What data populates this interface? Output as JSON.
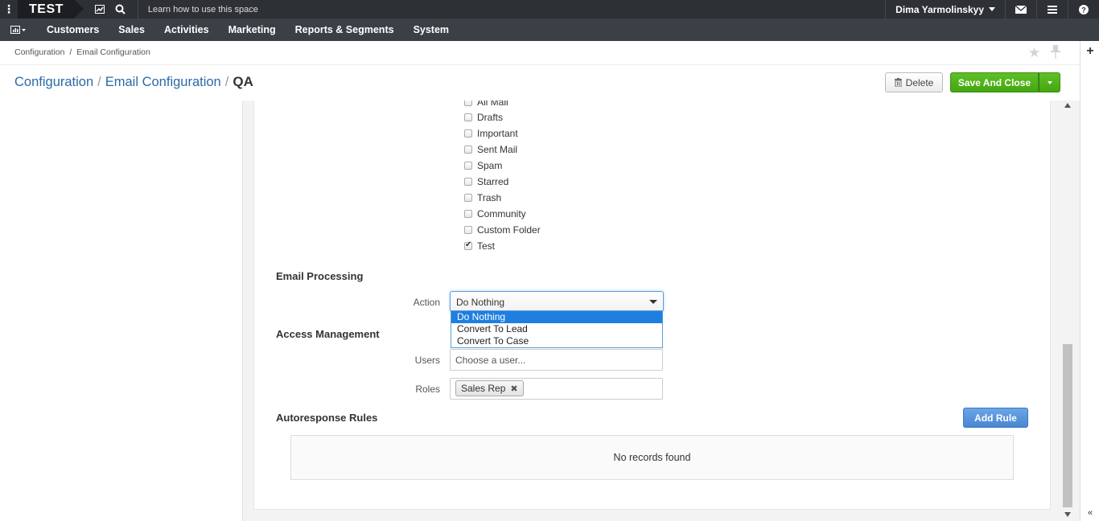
{
  "topbar": {
    "org_name": "TEST",
    "learn_text": "Learn how to use this space",
    "user_name": "Dima Yarmolinskyy",
    "icons": [
      "dots-icon",
      "chart-icon",
      "search-icon",
      "envelope-icon",
      "menu-icon",
      "help-icon"
    ]
  },
  "menu": {
    "items": [
      {
        "label": "Customers"
      },
      {
        "label": "Sales"
      },
      {
        "label": "Activities"
      },
      {
        "label": "Marketing"
      },
      {
        "label": "Reports & Segments"
      },
      {
        "label": "System"
      }
    ]
  },
  "breadcrumb": {
    "item1": "Configuration",
    "sep": "/",
    "item2": "Email Configuration"
  },
  "title": {
    "part1": "Configuration",
    "sep": "/",
    "part2": "Email Configuration",
    "current": "QA"
  },
  "actions": {
    "delete_label": "Delete",
    "save_label": "Save And Close"
  },
  "folders": {
    "items": [
      {
        "label": "All Mail",
        "checked": false
      },
      {
        "label": "Drafts",
        "checked": false
      },
      {
        "label": "Important",
        "checked": false
      },
      {
        "label": "Sent Mail",
        "checked": false
      },
      {
        "label": "Spam",
        "checked": false
      },
      {
        "label": "Starred",
        "checked": false
      },
      {
        "label": "Trash",
        "checked": false
      },
      {
        "label": "Community",
        "checked": false
      },
      {
        "label": "Custom Folder",
        "checked": false
      },
      {
        "label": "Test",
        "checked": true
      }
    ]
  },
  "email_processing": {
    "heading": "Email Processing",
    "action_label": "Action",
    "action_value": "Do Nothing",
    "options": [
      "Do Nothing",
      "Convert To Lead",
      "Convert To Case"
    ]
  },
  "access": {
    "heading": "Access Management",
    "users_label": "Users",
    "users_placeholder": "Choose a user...",
    "roles_label": "Roles",
    "role_tag": "Sales Rep"
  },
  "autoresponse": {
    "heading": "Autoresponse Rules",
    "add_label": "Add Rule",
    "empty_text": "No records found"
  },
  "colors": {
    "topbar_bg": "#2d3034",
    "menubar_bg": "#3b4046",
    "link_blue": "#2a6aa8",
    "save_green": "#4cae18",
    "add_blue": "#4a86d0",
    "dropdown_selected": "#1e7fe0"
  }
}
